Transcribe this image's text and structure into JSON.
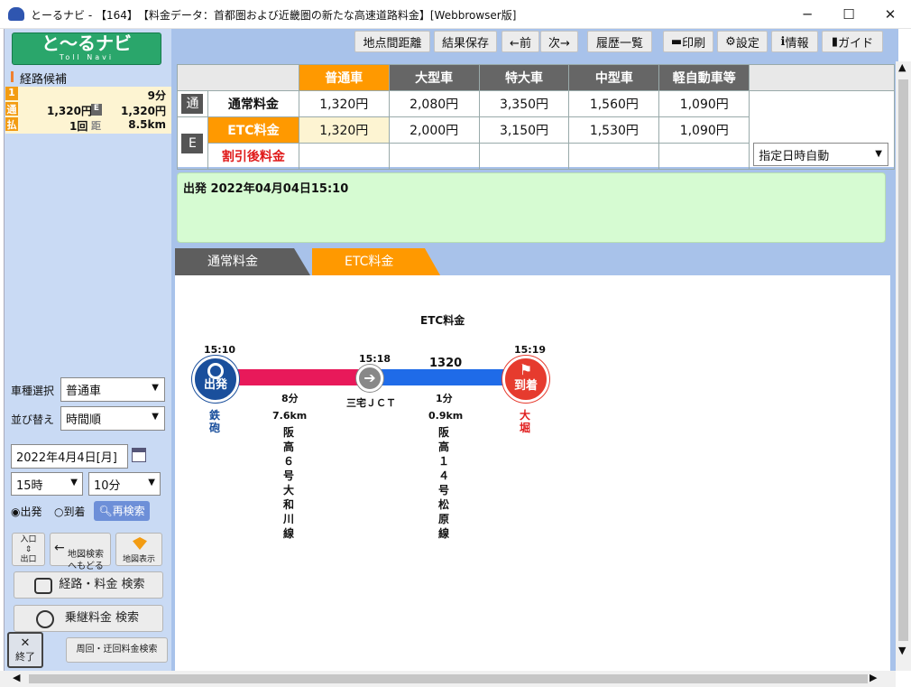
{
  "window": {
    "title": "とーるナビ - 【164】　【料金データ：首都圏および近畿圏の新たな高速道路料金】[Webbrowser版]",
    "min": "─",
    "max": "☐",
    "close": "✕"
  },
  "logo": {
    "main": "と〜るナビ",
    "sub": "Toll Navi"
  },
  "route_candidates": {
    "header": "経路候補",
    "items": [
      {
        "index": "1",
        "time": "9分",
        "normal_label": "通",
        "normal_fare": "1,320円",
        "etc_label": "E",
        "etc_fare": "1,320円",
        "pay_label": "払",
        "pay_count": "1回",
        "dist_label": "距",
        "distance": "8.5km"
      }
    ]
  },
  "search": {
    "vehicle_label": "車種選択",
    "vehicle_value": "普通車",
    "sort_label": "並び替え",
    "sort_value": "時間順",
    "date_value": "2022年4月4日[月]",
    "hour_value": "15時",
    "minute_value": "10分",
    "depart_label": "出発",
    "arrive_label": "到着",
    "research_label": "再検索",
    "entrance_label": "入口\n⇕\n出口",
    "map_back_label": "地図検索\nへもどる",
    "map_show_label": "地図表示",
    "route_search_label": "経路・料金 検索",
    "transfer_search_label": "乗継料金 検索",
    "exit_label": "終了",
    "detour_label": "周回・迂回料金検索"
  },
  "toolbar": {
    "distance": "地点間距離",
    "save": "結果保存",
    "prev": "←前",
    "next": "次→",
    "history": "履歴一覧",
    "print": "印刷",
    "settings": "設定",
    "info": "情報",
    "guide": "ガイド"
  },
  "fare_table": {
    "headers": [
      "普通車",
      "大型車",
      "特大車",
      "中型車",
      "軽自動車等"
    ],
    "normal_icon": "通",
    "normal_label": "通常料金",
    "normal": [
      "1,320円",
      "2,080円",
      "3,350円",
      "1,560円",
      "1,090円"
    ],
    "etc_icon": "E",
    "etc_label": "ETC料金",
    "etc": [
      "1,320円",
      "2,000円",
      "3,150円",
      "1,530円",
      "1,090円"
    ],
    "discount_label": "割引後料金",
    "date_mode": "指定日時自動"
  },
  "info_box": {
    "text": "出発 2022年04月04日15:10"
  },
  "tabs": {
    "normal": "通常料金",
    "etc": "ETC料金"
  },
  "diagram": {
    "title": "ETC料金",
    "start": {
      "time": "15:10",
      "label": "出発",
      "name": "鉄\n砲"
    },
    "mid": {
      "time": "15:18",
      "name": "三宅ＪＣＴ"
    },
    "end": {
      "time": "15:19",
      "label": "到着",
      "name": "大\n堀"
    },
    "seg1": {
      "duration": "8分",
      "distance": "7.6km",
      "road": "阪\n高\n６\n号\n大\n和\n川\n線"
    },
    "seg2": {
      "fare": "1320",
      "duration": "1分",
      "distance": "0.9km",
      "road": "阪\n高\n１\n４\n号\n松\n原\n線"
    }
  },
  "colors": {
    "accent": "#ff9900",
    "left_bg": "#c9daf4",
    "segment1": "#e8195a",
    "segment2": "#1f6be8",
    "start": "#1a4f9c",
    "end": "#e63b2e"
  }
}
